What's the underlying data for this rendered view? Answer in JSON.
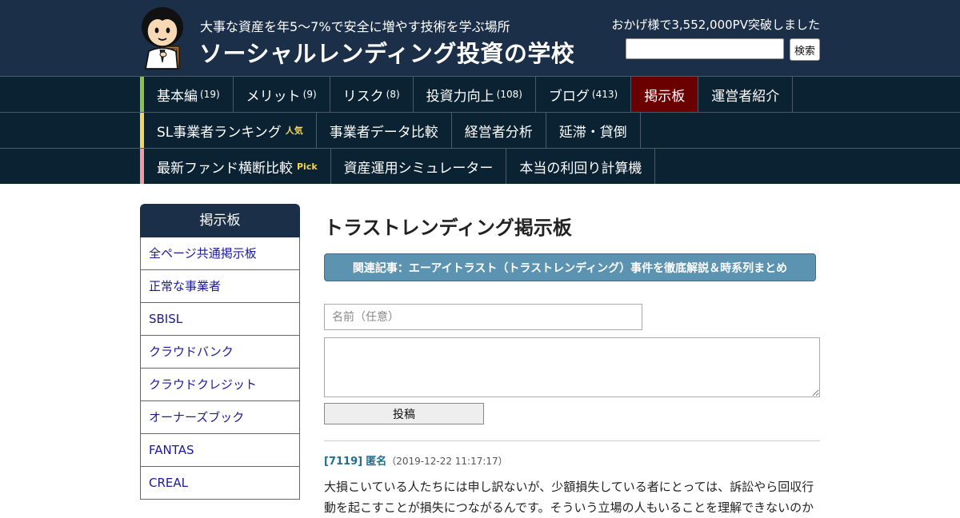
{
  "header": {
    "tagline": "大事な資産を年5～7%で安全に増やす技術を学ぶ場所",
    "site_title": "ソーシャルレンディング投資の学校",
    "pv_count": "おかげ様で3,552,000PV突破しました",
    "search_button": "検索",
    "search_value": ""
  },
  "nav": {
    "row1": [
      {
        "label": "基本編",
        "count": "(19)"
      },
      {
        "label": "メリット",
        "count": "(9)"
      },
      {
        "label": "リスク",
        "count": "(8)"
      },
      {
        "label": "投資力向上",
        "count": "(108)"
      },
      {
        "label": "ブログ",
        "count": "(413)"
      },
      {
        "label": "掲示板",
        "active": true
      },
      {
        "label": "運営者紹介"
      }
    ],
    "row2": [
      {
        "label": "SL事業者ランキング",
        "badge": "人気"
      },
      {
        "label": "事業者データ比較"
      },
      {
        "label": "経営者分析"
      },
      {
        "label": "延滞・貸倒"
      }
    ],
    "row3": [
      {
        "label": "最新ファンド横断比較",
        "badge": "Pick"
      },
      {
        "label": "資産運用シミュレーター"
      },
      {
        "label": "本当の利回り計算機"
      }
    ],
    "accent_colors": [
      "#8bc34a",
      "#f4d35e",
      "#f19aa0"
    ],
    "active_color": "#6a0000"
  },
  "sidebar": {
    "title": "掲示板",
    "items": [
      "全ページ共通掲示板",
      "正常な事業者",
      "SBISL",
      "クラウドバンク",
      "クラウドクレジット",
      "オーナーズブック",
      "FANTAS",
      "CREAL"
    ]
  },
  "main": {
    "title": "トラストレンディング掲示板",
    "related_link": "関連記事：エーアイトラスト（トラストレンディング）事件を徹底解説＆時系列まとめ",
    "name_placeholder": "名前（任意）",
    "message_value": "",
    "submit_label": "投稿",
    "post": {
      "id": "[7119]",
      "author": "匿名",
      "time": "（2019-12-22 11:17:17）",
      "body": "大損こいている人たちには申し訳ないが、少額損失している者にとっては、訴訟やら回収行動を起こすことが損失につながるんです。そういう立場の人もいることを理解できないのか"
    }
  },
  "colors": {
    "header_bg": "#1b3048",
    "nav_bg": "#0b2233",
    "link": "#1a1a9a",
    "related_bg": "#5b93b0",
    "post_accent": "#1e6e8c"
  },
  "icons": {
    "avatar": "cartoon-boy-with-book-avatar"
  }
}
